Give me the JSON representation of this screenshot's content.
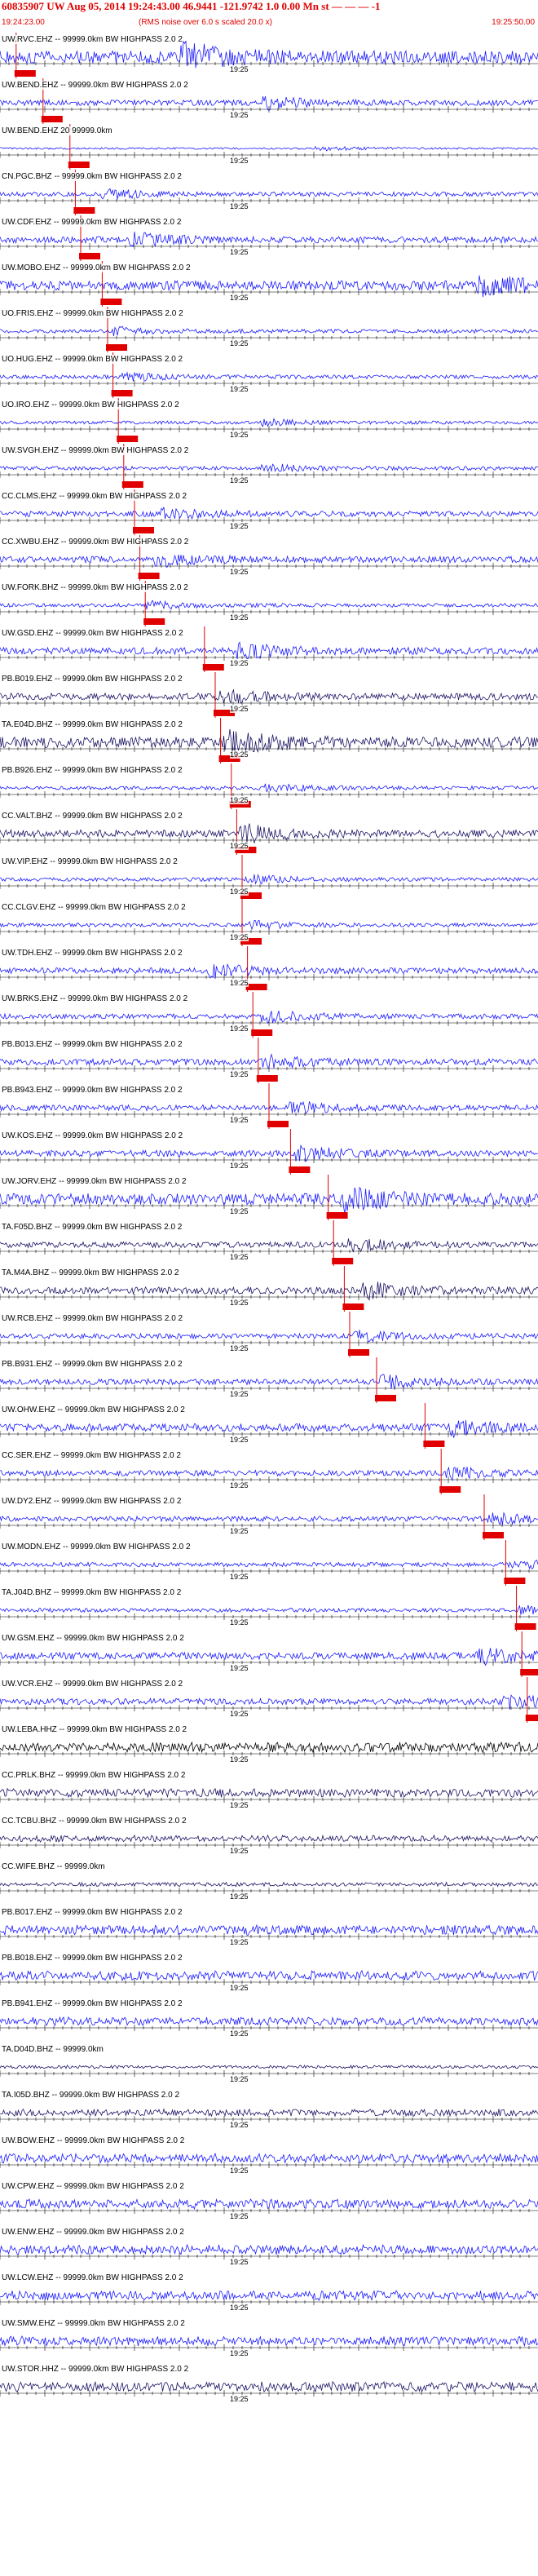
{
  "header": {
    "title": "60835907 UW Aug 05, 2014 19:24:43.00   46.9441 -121.9742  1.0 0.00 Mn st — — — -1",
    "start_time": "19:24:23.00",
    "note": "(RMS noise over 6.0 s scaled 20.0 x)",
    "end_time": "19:25:50.00"
  },
  "tick_label": "19:25",
  "colors": {
    "header": "#e00000",
    "pick_marker": "#e00000",
    "trace_blue": "#1a1aff",
    "trace_navy": "#1b1464",
    "trace_black": "#000000",
    "timeline": "#000000"
  },
  "traces": [
    {
      "label": "UW.RVC.EHZ -- 99999.0km BW  HIGHPASS  2.0  2",
      "color": "blue",
      "pick": 0.03,
      "amp": 1.0,
      "burst": 0.35
    },
    {
      "label": "UW.BEND.EHZ -- 99999.0km BW  HIGHPASS  2.0  2",
      "color": "blue",
      "pick": 0.08,
      "amp": 0.45,
      "burst": 0.5
    },
    {
      "label": "UW.BEND.EHZ 20 99999.0km",
      "color": "blue",
      "pick": 0.13,
      "amp": 0.15,
      "burst": 0.6
    },
    {
      "label": "CN.PGC.BHZ -- 99999.0km BW  HIGHPASS  2.0  2",
      "color": "blue",
      "pick": 0.14,
      "amp": 0.35,
      "burst": 0.2
    },
    {
      "label": "UW.CDF.EHZ -- 99999.0km BW  HIGHPASS  2.0  2",
      "color": "blue",
      "pick": 0.15,
      "amp": 0.5,
      "burst": 0.25
    },
    {
      "label": "UW.MOBO.EHZ -- 99999.0km BW  HIGHPASS  2.0  2",
      "color": "blue",
      "pick": 0.19,
      "amp": 0.75,
      "burst": 0.9
    },
    {
      "label": "UO.FRIS.EHZ -- 99999.0km BW  HIGHPASS  2.0  2",
      "color": "blue",
      "pick": 0.2,
      "amp": 0.3,
      "burst": 0.22
    },
    {
      "label": "UO.HUG.EHZ -- 99999.0km BW  HIGHPASS  2.0  2",
      "color": "blue",
      "pick": 0.21,
      "amp": 0.3,
      "burst": 0.24
    },
    {
      "label": "UO.IRO.EHZ -- 99999.0km BW  HIGHPASS  2.0  2",
      "color": "blue",
      "pick": 0.22,
      "amp": 0.25,
      "burst": 0.5
    },
    {
      "label": "UW.SVGH.EHZ -- 99999.0km BW  HIGHPASS  2.0  2",
      "color": "blue",
      "pick": 0.23,
      "amp": 0.3,
      "burst": 0.5
    },
    {
      "label": "CC.CLMS.EHZ -- 99999.0km BW  HIGHPASS  2.0  2",
      "color": "blue",
      "pick": 0.25,
      "amp": 0.45,
      "burst": 0.3
    },
    {
      "label": "CC.XWBU.EHZ -- 99999.0km BW  HIGHPASS  2.0  2",
      "color": "blue",
      "pick": 0.26,
      "amp": 0.5,
      "burst": 0.3
    },
    {
      "label": "UW.FORK.BHZ -- 99999.0km BW  HIGHPASS  2.0  2",
      "color": "blue",
      "pick": 0.27,
      "amp": 0.3,
      "burst": 0.28
    },
    {
      "label": "UW.GSD.EHZ -- 99999.0km BW  HIGHPASS  2.0  2",
      "color": "blue",
      "pick": 0.38,
      "amp": 0.55,
      "burst": 0.45
    },
    {
      "label": "PB.B019.EHZ -- 99999.0km BW  HIGHPASS  2.0  2",
      "color": "navy",
      "pick": 0.4,
      "amp": 0.55,
      "burst": 0.4
    },
    {
      "label": "TA.E04D.BHZ -- 99999.0km BW  HIGHPASS  2.0  2",
      "color": "navy",
      "pick": 0.41,
      "amp": 0.85,
      "burst": 0.43
    },
    {
      "label": "PB.B926.EHZ -- 99999.0km BW  HIGHPASS  2.0  2",
      "color": "blue",
      "pick": 0.43,
      "amp": 0.3,
      "burst": 0.5
    },
    {
      "label": "CC.VALT.BHZ -- 99999.0km BW  HIGHPASS  2.0  2",
      "color": "navy",
      "pick": 0.44,
      "amp": 0.6,
      "burst": 0.46
    },
    {
      "label": "UW.VIP.EHZ -- 99999.0km BW  HIGHPASS  2.0  2",
      "color": "blue",
      "pick": 0.45,
      "amp": 0.3,
      "burst": 0.47
    },
    {
      "label": "CC.CLGV.EHZ -- 99999.0km BW  HIGHPASS  2.0  2",
      "color": "blue",
      "pick": 0.45,
      "amp": 0.3,
      "burst": 0.47
    },
    {
      "label": "UW.TDH.EHZ -- 99999.0km BW  HIGHPASS  2.0  2",
      "color": "blue",
      "pick": 0.46,
      "amp": 0.45,
      "burst": 0.4
    },
    {
      "label": "UW.BRKS.EHZ -- 99999.0km BW  HIGHPASS  2.0  2",
      "color": "blue",
      "pick": 0.47,
      "amp": 0.4,
      "burst": 0.5
    },
    {
      "label": "PB.B013.EHZ -- 99999.0km BW  HIGHPASS  2.0  2",
      "color": "blue",
      "pick": 0.48,
      "amp": 0.5,
      "burst": 0.5
    },
    {
      "label": "PB.B943.EHZ -- 99999.0km BW  HIGHPASS  2.0  2",
      "color": "blue",
      "pick": 0.5,
      "amp": 0.45,
      "burst": 0.55
    },
    {
      "label": "UW.KOS.EHZ -- 99999.0km BW  HIGHPASS  2.0  2",
      "color": "blue",
      "pick": 0.54,
      "amp": 0.5,
      "burst": 0.56
    },
    {
      "label": "UW.JORV.EHZ -- 99999.0km BW  HIGHPASS  2.0  2",
      "color": "blue",
      "pick": 0.61,
      "amp": 0.9,
      "burst": 0.65
    },
    {
      "label": "TA.F05D.BHZ -- 99999.0km BW  HIGHPASS  2.0  2",
      "color": "navy",
      "pick": 0.62,
      "amp": 0.45,
      "burst": 0.66
    },
    {
      "label": "TA.M4A.BHZ -- 99999.0km BW  HIGHPASS  2.0  2",
      "color": "navy",
      "pick": 0.64,
      "amp": 0.55,
      "burst": 0.69
    },
    {
      "label": "UW.RCB.EHZ -- 99999.0km BW  HIGHPASS  2.0  2",
      "color": "blue",
      "pick": 0.65,
      "amp": 0.4,
      "burst": 0.67
    },
    {
      "label": "PB.B931.EHZ -- 99999.0km BW  HIGHPASS  2.0  2",
      "color": "blue",
      "pick": 0.7,
      "amp": 0.45,
      "burst": 0.72
    },
    {
      "label": "UW.OHW.EHZ -- 99999.0km BW  HIGHPASS  2.0  2",
      "color": "blue",
      "pick": 0.79,
      "amp": 0.6,
      "burst": 0.85
    },
    {
      "label": "CC.SER.EHZ -- 99999.0km BW  HIGHPASS  2.0  2",
      "color": "blue",
      "pick": 0.82,
      "amp": 0.45,
      "burst": 0.84
    },
    {
      "label": "UW.DY2.EHZ -- 99999.0km BW  HIGHPASS  2.0  2",
      "color": "blue",
      "pick": 0.9,
      "amp": 0.4,
      "burst": 0.92
    },
    {
      "label": "UW.MODN.EHZ -- 99999.0km BW  HIGHPASS  2.0  2",
      "color": "blue",
      "pick": 0.94,
      "amp": 0.35,
      "burst": 0.96
    },
    {
      "label": "TA.J04D.BHZ -- 99999.0km BW  HIGHPASS  2.0  2",
      "color": "blue",
      "pick": 0.96,
      "amp": 0.3,
      "burst": 0.98
    },
    {
      "label": "UW.GSM.EHZ -- 99999.0km BW  HIGHPASS  2.0  2",
      "color": "blue",
      "pick": 0.97,
      "amp": 0.55,
      "burst": 0.9
    },
    {
      "label": "UW.VCR.EHZ -- 99999.0km BW  HIGHPASS  2.0  2",
      "color": "blue",
      "pick": 0.98,
      "amp": 0.5,
      "burst": 0.95
    },
    {
      "label": "UW.LEBA.HHZ -- 99999.0km BW  HIGHPASS  2.0  2",
      "color": "black",
      "pick": null,
      "amp": 0.3,
      "burst": -1
    },
    {
      "label": "CC.PRLK.BHZ -- 99999.0km BW  HIGHPASS  2.0  2",
      "color": "navy",
      "pick": null,
      "amp": 0.25,
      "burst": -1
    },
    {
      "label": "CC.TCBU.BHZ -- 99999.0km BW  HIGHPASS  2.0  2",
      "color": "navy",
      "pick": null,
      "amp": 0.2,
      "burst": -1
    },
    {
      "label": "CC.WIFE.BHZ -- 99999.0km",
      "color": "navy",
      "pick": null,
      "amp": 0.12,
      "burst": -1
    },
    {
      "label": "PB.B017.EHZ -- 99999.0km BW  HIGHPASS  2.0  2",
      "color": "blue",
      "pick": null,
      "amp": 0.3,
      "burst": -1
    },
    {
      "label": "PB.B018.EHZ -- 99999.0km BW  HIGHPASS  2.0  2",
      "color": "blue",
      "pick": null,
      "amp": 0.28,
      "burst": -1
    },
    {
      "label": "PB.B941.EHZ -- 99999.0km BW  HIGHPASS  2.0  2",
      "color": "blue",
      "pick": null,
      "amp": 0.25,
      "burst": -1
    },
    {
      "label": "TA.D04D.BHZ -- 99999.0km",
      "color": "navy",
      "pick": null,
      "amp": 0.1,
      "burst": -1
    },
    {
      "label": "TA.I05D.BHZ -- 99999.0km BW  HIGHPASS  2.0  2",
      "color": "navy",
      "pick": null,
      "amp": 0.22,
      "burst": -1
    },
    {
      "label": "UW.BOW.EHZ -- 99999.0km BW  HIGHPASS  2.0  2",
      "color": "blue",
      "pick": null,
      "amp": 0.28,
      "burst": -1
    },
    {
      "label": "UW.CPW.EHZ -- 99999.0km BW  HIGHPASS  2.0  2",
      "color": "blue",
      "pick": null,
      "amp": 0.28,
      "burst": -1
    },
    {
      "label": "UW.ENW.EHZ -- 99999.0km BW  HIGHPASS  2.0  2",
      "color": "blue",
      "pick": null,
      "amp": 0.28,
      "burst": -1
    },
    {
      "label": "UW.LCW.EHZ -- 99999.0km BW  HIGHPASS  2.0  2",
      "color": "blue",
      "pick": null,
      "amp": 0.28,
      "burst": -1
    },
    {
      "label": "UW.SMW.EHZ -- 99999.0km BW  HIGHPASS  2.0  2",
      "color": "blue",
      "pick": null,
      "amp": 0.28,
      "burst": -1
    },
    {
      "label": "UW.STOR.HHZ -- 99999.0km BW  HIGHPASS  2.0  2",
      "color": "navy",
      "pick": null,
      "amp": 0.3,
      "burst": -1
    }
  ]
}
